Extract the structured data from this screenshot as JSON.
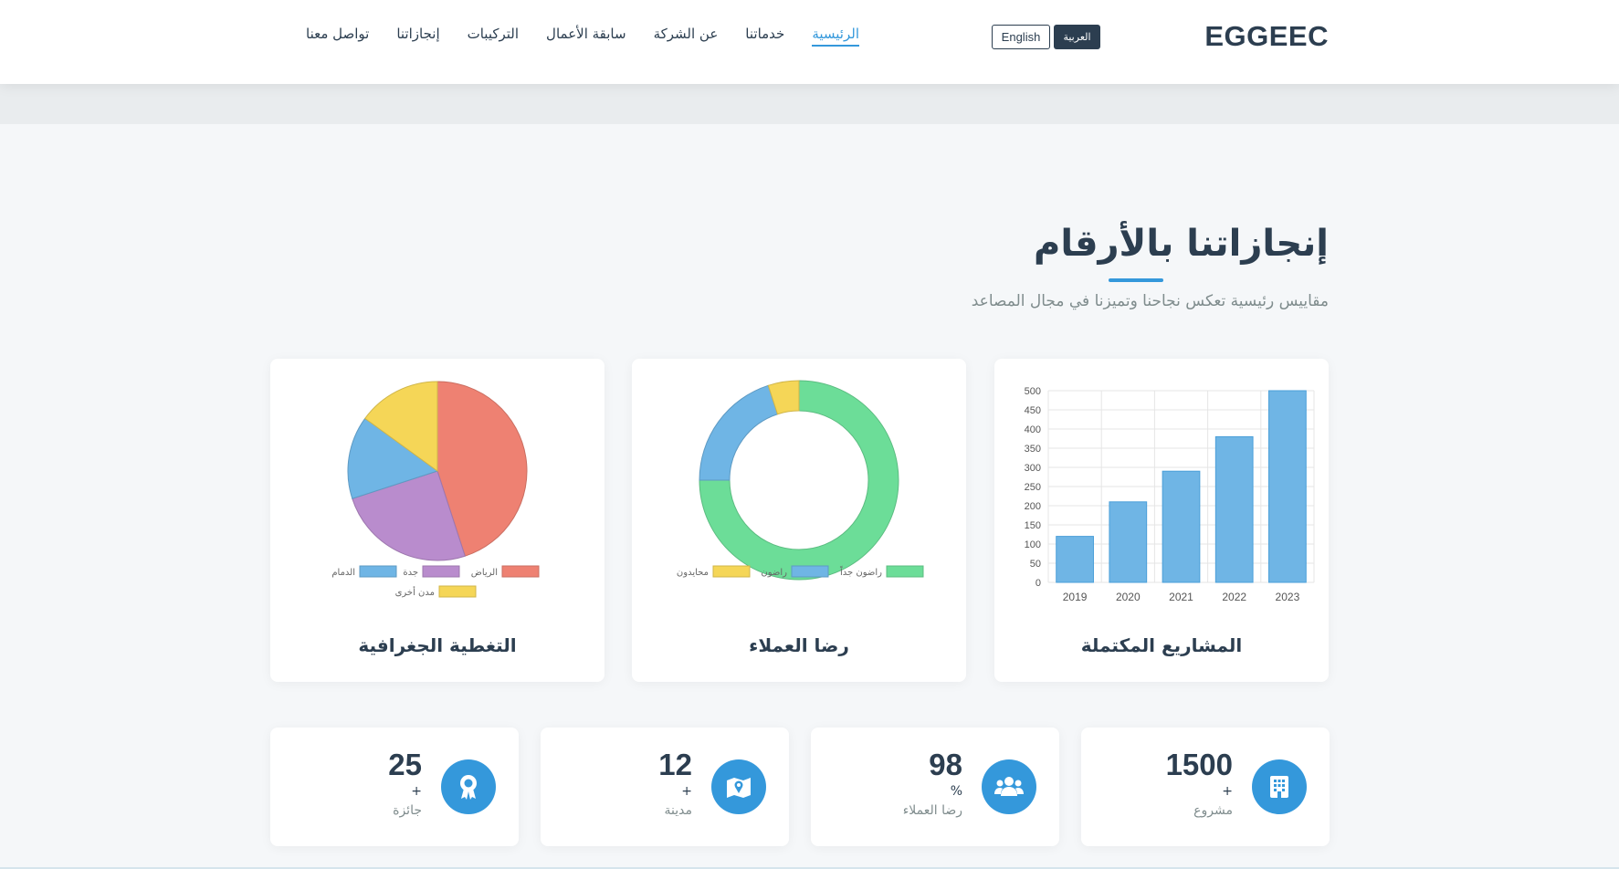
{
  "header": {
    "logo": "EGGEEC",
    "lang_ar": "العربية",
    "lang_en": "English",
    "nav": [
      "الرئيسية",
      "خدماتنا",
      "عن الشركة",
      "سابقة الأعمال",
      "التركيبات",
      "إنجازاتنا",
      "تواصل معنا"
    ],
    "active_nav": "الرئيسية"
  },
  "section": {
    "title": "إنجازاتنا بالأرقام",
    "subtitle": "مقاييس رئيسية تعكس نجاحنا وتميزنا في مجال المصاعد"
  },
  "colors": {
    "accent": "#3498db",
    "dark": "#2c3e50",
    "blue": "#6fb5e5",
    "green": "#6cdd98",
    "yellow": "#f5d657",
    "red": "#ee8172",
    "purple": "#b98ccd"
  },
  "cards": {
    "projects_title": "المشاريع المكتملة",
    "satisfaction_title": "رضا العملاء",
    "coverage_title": "التغطية الجغرافية"
  },
  "chart_data": [
    {
      "type": "bar",
      "title": "المشاريع المكتملة",
      "categories": [
        "2019",
        "2020",
        "2021",
        "2022",
        "2023"
      ],
      "values": [
        120,
        210,
        290,
        380,
        500
      ],
      "ylim": [
        0,
        500
      ],
      "yticks": [
        0,
        50,
        100,
        150,
        200,
        250,
        300,
        350,
        400,
        450,
        500
      ],
      "grid": true,
      "color": "#6fb5e5"
    },
    {
      "type": "pie",
      "variant": "doughnut",
      "title": "رضا العملاء",
      "labels": [
        "راضون جداً",
        "راضون",
        "محايدون"
      ],
      "values": [
        75,
        20,
        5
      ],
      "colors": [
        "#6cdd98",
        "#6fb5e5",
        "#f5d657"
      ],
      "legend": "bottom"
    },
    {
      "type": "pie",
      "title": "التغطية الجغرافية",
      "labels": [
        "الرياض",
        "جدة",
        "الدمام",
        "مدن أخرى"
      ],
      "values": [
        45,
        25,
        15,
        15
      ],
      "colors": [
        "#ee8172",
        "#b98ccd",
        "#6fb5e5",
        "#f5d657"
      ],
      "legend": "bottom"
    }
  ],
  "stats": [
    {
      "value": "1500",
      "suffix": "+",
      "label": "مشروع",
      "icon": "building-icon"
    },
    {
      "value": "98",
      "suffix": "%",
      "label": "رضا العملاء",
      "icon": "users-icon"
    },
    {
      "value": "12",
      "suffix": "+",
      "label": "مدينة",
      "icon": "map-icon"
    },
    {
      "value": "25",
      "suffix": "+",
      "label": "جائزة",
      "icon": "award-icon"
    }
  ]
}
